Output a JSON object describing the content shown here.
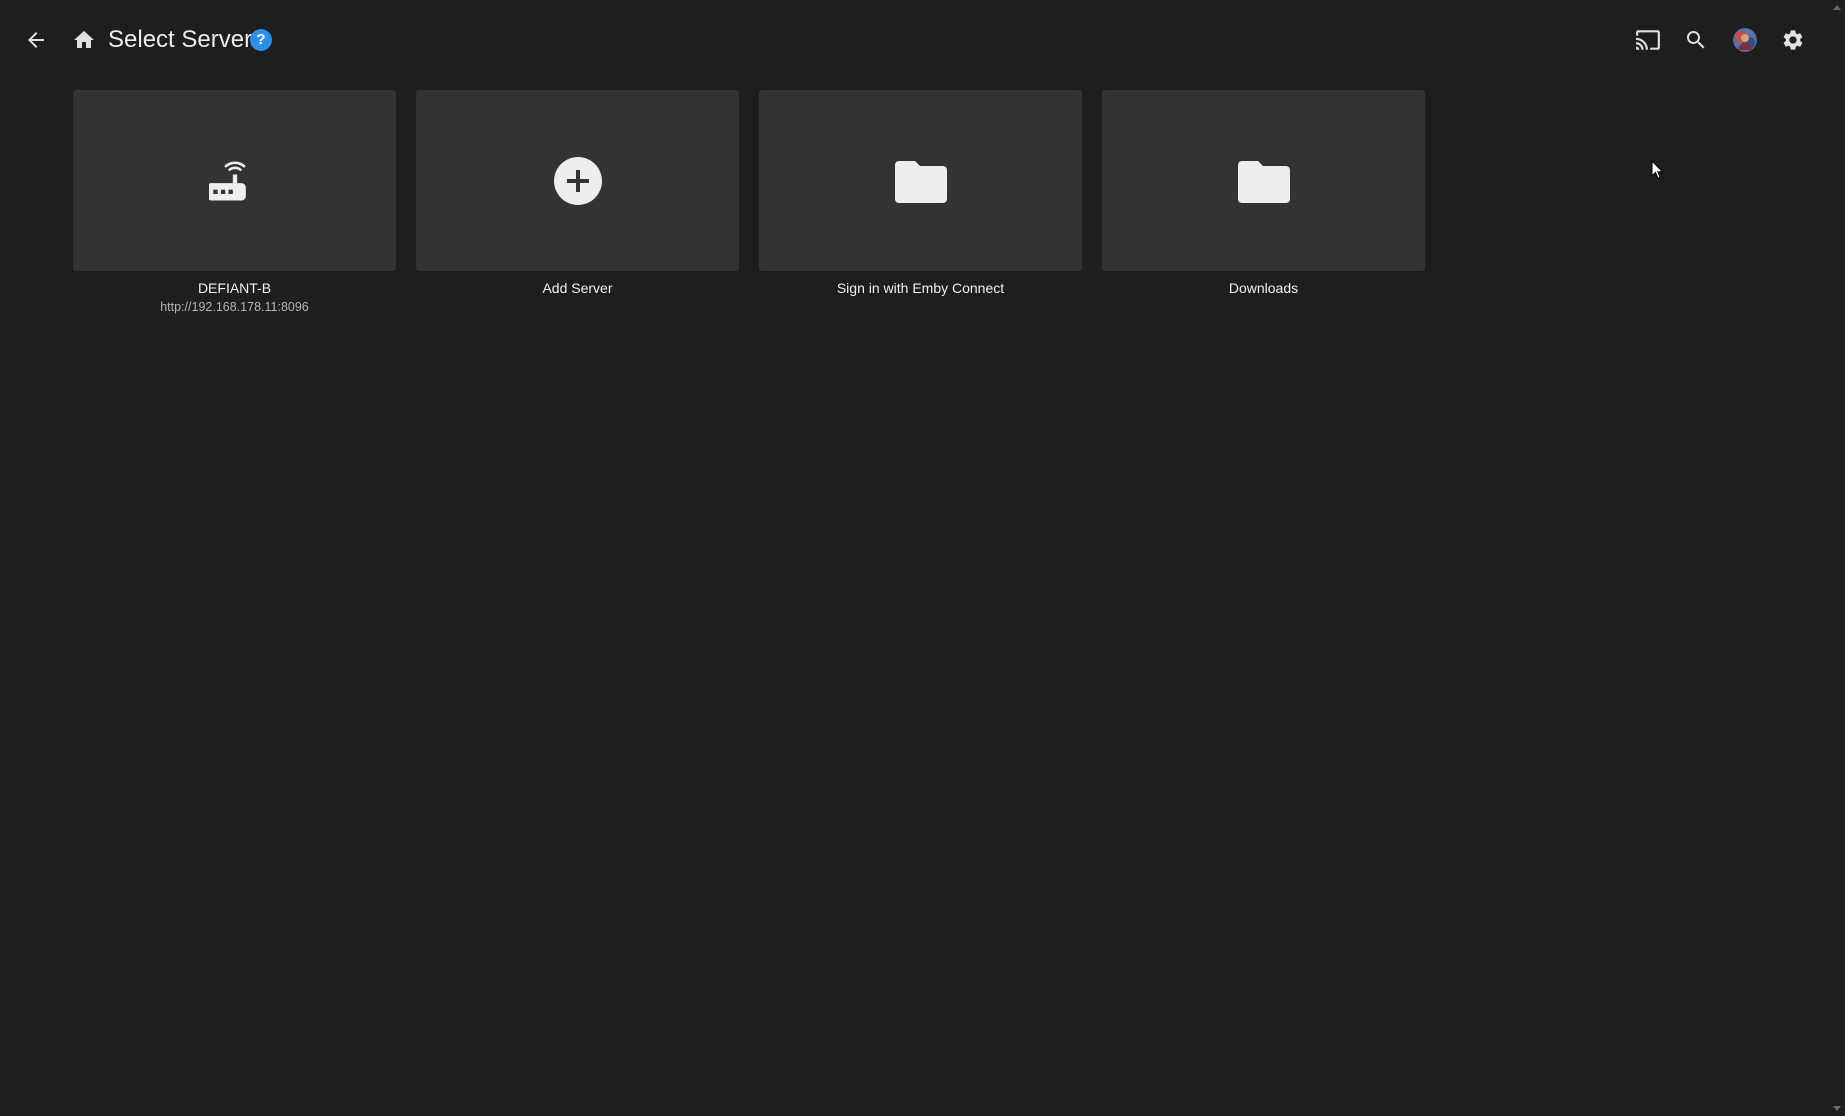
{
  "header": {
    "title": "Select Server",
    "help_label": "?",
    "icons": {
      "back": "arrow-left-icon",
      "home": "home-icon",
      "cast": "cast-icon",
      "search": "search-icon",
      "avatar": "user-avatar",
      "settings": "gear-icon"
    }
  },
  "cards": [
    {
      "title": "DEFIANT-B",
      "subtitle": "http://192.168.178.11:8096",
      "icon": "router-icon"
    },
    {
      "title": "Add Server",
      "subtitle": "",
      "icon": "add-circle-icon"
    },
    {
      "title": "Sign in with Emby Connect",
      "subtitle": "",
      "icon": "folder-icon"
    },
    {
      "title": "Downloads",
      "subtitle": "",
      "icon": "folder-icon"
    }
  ],
  "colors": {
    "background": "#1e1e1e",
    "card": "#333333",
    "accent": "#2c8fe8",
    "text": "#f0f0f0",
    "subtext": "#b5b5b5"
  }
}
